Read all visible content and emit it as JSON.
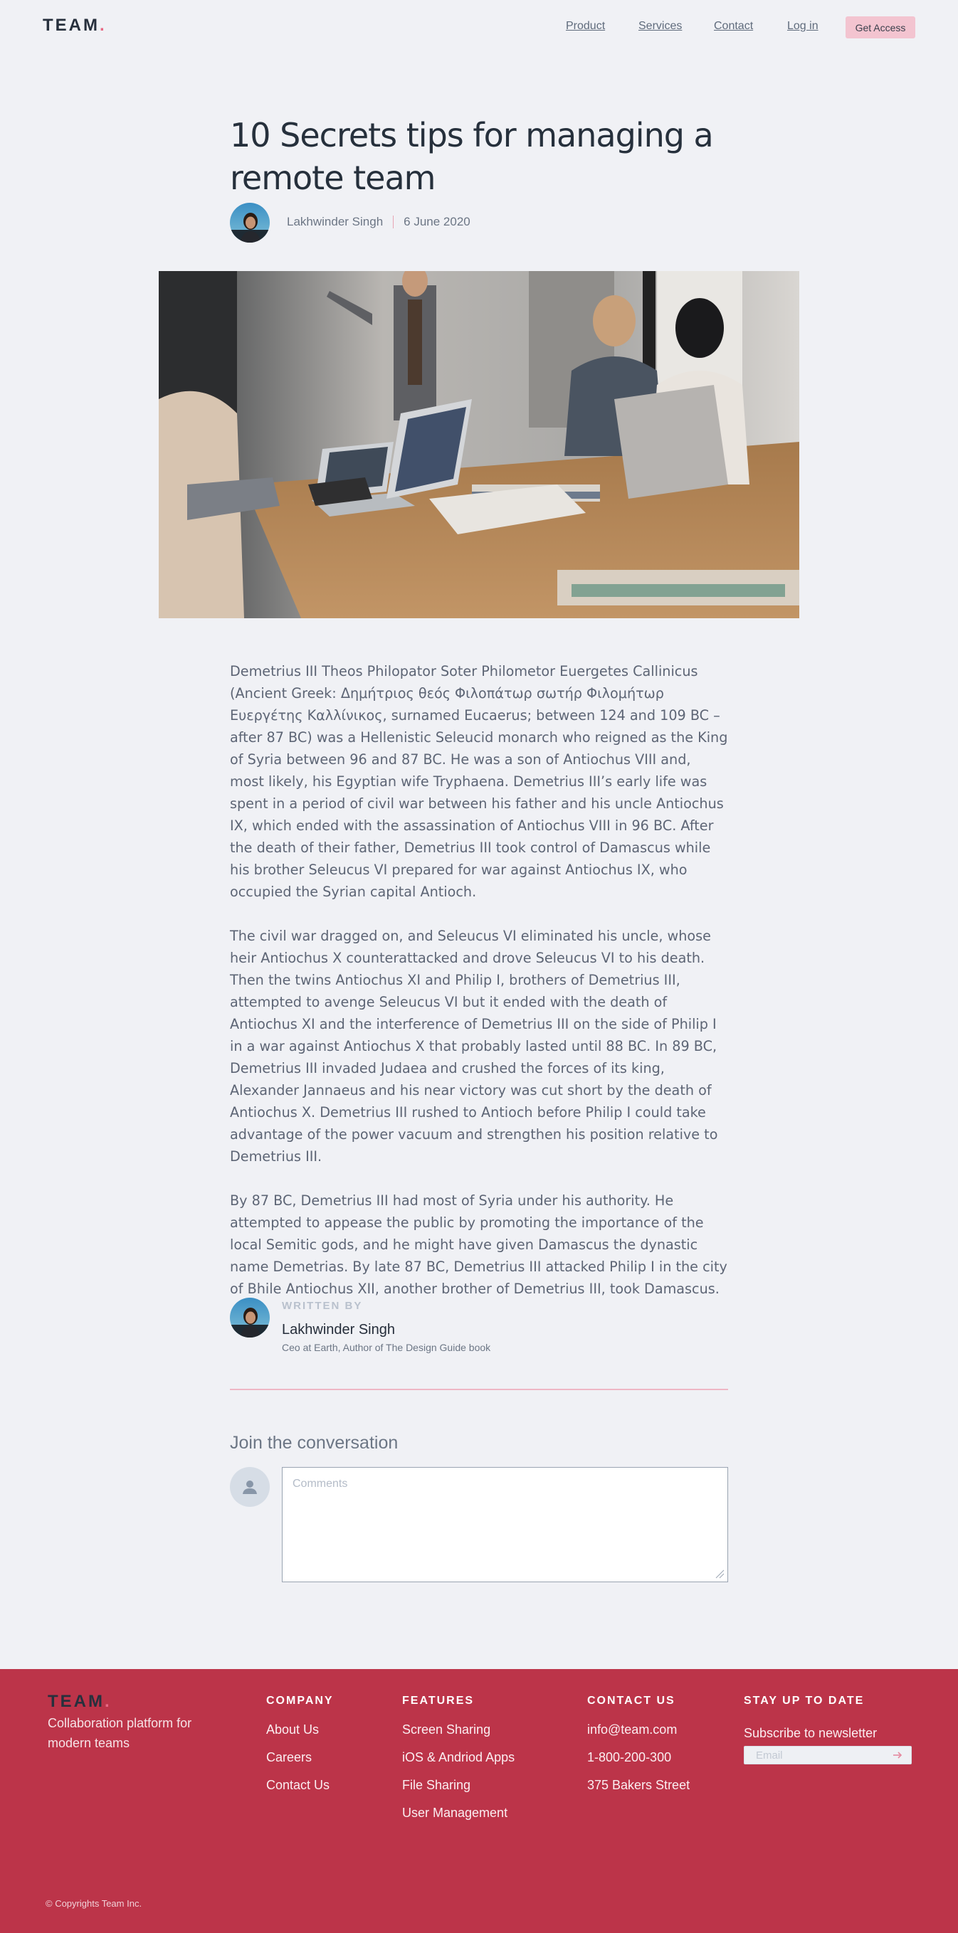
{
  "brand": {
    "name": "TEAM",
    "dot": ".",
    "accent": "#e86a85",
    "primary": "#bc3449"
  },
  "nav": {
    "items": [
      "Product",
      "Services",
      "Contact",
      "Log in"
    ],
    "cta": "Get Access"
  },
  "article": {
    "title": "10 Secrets tips for managing a remote team",
    "author": "Lakhwinder Singh",
    "date": "6 June 2020",
    "paragraphs": [
      "Demetrius III Theos Philopator Soter Philometor Euergetes Callinicus (Ancient Greek: Δημήτριος θεός Φιλοπάτωρ σωτήρ Φιλομήτωρ Ευεργέτης Καλλίνικος, surnamed Eucaerus; between 124 and 109 BC – after 87 BC) was a Hellenistic Seleucid monarch who reigned as the King of Syria between 96 and 87 BC. He was a son of Antiochus VIII and, most likely, his Egyptian wife Tryphaena. Demetrius III’s early life was spent in a period of civil war between his father and his uncle Antiochus IX, which ended with the assassination of Antiochus VIII in 96 BC. After the death of their father, Demetrius III took control of Damascus while his brother Seleucus VI prepared for war against Antiochus IX, who occupied the Syrian capital Antioch.",
      "The civil war dragged on, and Seleucus VI eliminated his uncle, whose heir Antiochus X counterattacked and drove Seleucus VI to his death. Then the twins Antiochus XI and Philip I, brothers of Demetrius III, attempted to avenge Seleucus VI but it ended with the death of Antiochus XI and the interference of Demetrius III on the side of Philip I in a war against Antiochus X that probably lasted until 88 BC. In 89 BC, Demetrius III invaded Judaea and crushed the forces of its king, Alexander Jannaeus and his near victory was cut short by the death of Antiochus X. Demetrius III rushed to Antioch before Philip I could take advantage of the power vacuum and strengthen his position relative to Demetrius III.",
      "By 87 BC, Demetrius III had most of Syria under his authority. He attempted to appease the public by promoting the importance of the local Semitic gods, and he might have given Damascus the dynastic name Demetrias. By late 87 BC, Demetrius III attacked Philip I in the city of Bhile Antiochus XII, another brother of Demetrius III, took Damascus."
    ],
    "written_by": {
      "label": "WRITTEN BY",
      "name": "Lakhwinder Singh",
      "bio": "Ceo at Earth, Author of The Design Guide book"
    }
  },
  "comments": {
    "heading": "Join the conversation",
    "placeholder": "Comments"
  },
  "footer": {
    "tagline": "Collaboration platform for modern teams",
    "company": {
      "heading": "COMPANY",
      "links": [
        "About Us",
        "Careers",
        "Contact Us"
      ]
    },
    "features": {
      "heading": "FEATURES",
      "links": [
        "Screen Sharing",
        "iOS & Andriod Apps",
        "File Sharing",
        "User Management"
      ]
    },
    "contact": {
      "heading": "CONTACT US",
      "items": [
        "info@team.com",
        "1-800-200-300",
        "375 Bakers Street"
      ]
    },
    "newsletter": {
      "heading": "STAY UP TO DATE",
      "label": "Subscribe to newsletter",
      "placeholder": "Email"
    },
    "copyright": "© Copyrights Team Inc."
  }
}
